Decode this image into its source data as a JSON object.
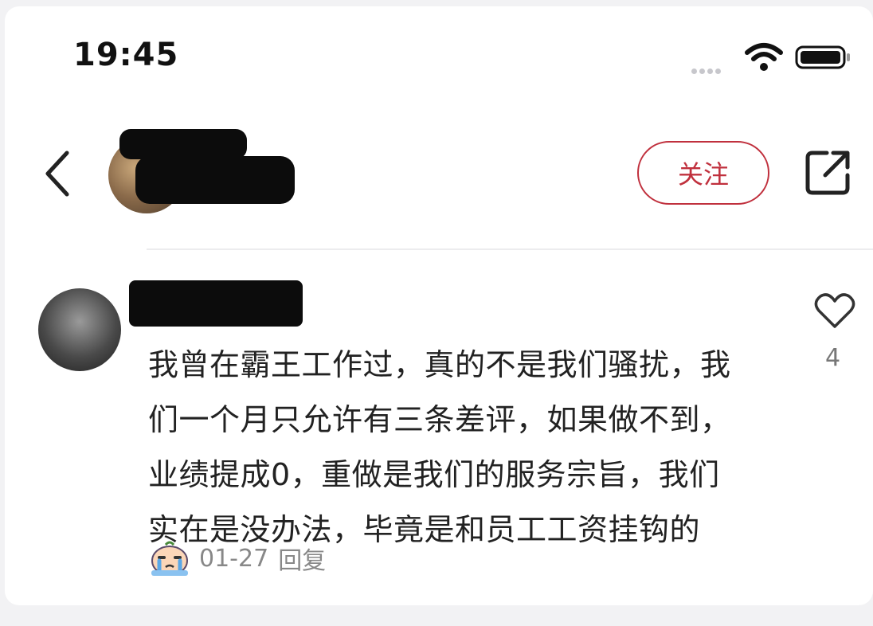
{
  "status_bar": {
    "time": "19:45"
  },
  "header": {
    "follow_label": "关注"
  },
  "comment": {
    "lines": [
      "我曾在霸王工作过，真的不是我们骚扰，我",
      "们一个月只允许有三条差评，如果做不到，",
      "业绩提成0，重做是我们的服务宗旨，我们",
      "实在是没办法，毕竟是和员工工资挂钩的"
    ],
    "date": "01-27",
    "reply_label": "回复",
    "like_count": "4"
  },
  "colors": {
    "accent": "#c0303d"
  }
}
